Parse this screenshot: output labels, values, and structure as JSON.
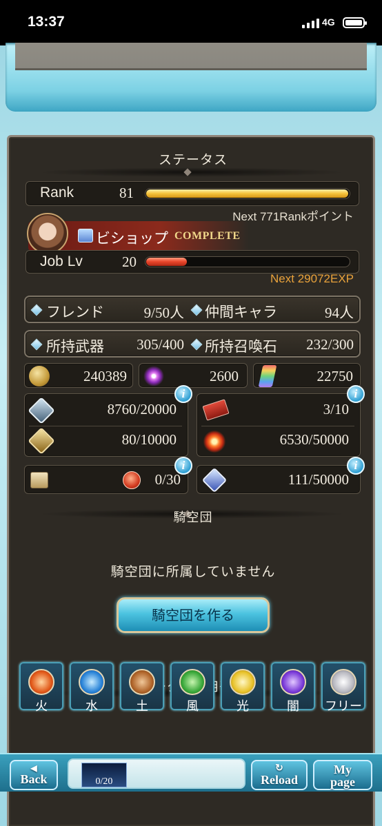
{
  "status_bar": {
    "time": "13:37",
    "network": "4G"
  },
  "status_panel": {
    "title": "ステータス",
    "rank": {
      "label": "Rank",
      "value": "81",
      "progress": 0.99,
      "next_text": "Next 771Rankポイント"
    },
    "job": {
      "class_name": "ビショップ",
      "complete_label": "COMPLETE",
      "label": "Job Lv",
      "value": "20",
      "progress": 0.2,
      "next_text": "Next 29072EXP"
    },
    "friends": {
      "label": "フレンド",
      "value": "9/50人"
    },
    "allies": {
      "label": "仲間キャラ",
      "value": "94人"
    },
    "weapons": {
      "label": "所持武器",
      "value": "305/400"
    },
    "summons": {
      "label": "所持召喚石",
      "value": "232/300"
    },
    "currencies": [
      {
        "icon": "rupie-coin-icon",
        "value": "240389"
      },
      {
        "icon": "crystal-star-icon",
        "value": "2600"
      },
      {
        "icon": "rainbow-crystal-icon",
        "value": "22750"
      }
    ],
    "items": [
      {
        "icon": "ap-potion-icon",
        "value": "8760/20000"
      },
      {
        "icon": "draw-ticket-icon",
        "value": "3/10"
      },
      {
        "icon": "bp-potion-icon",
        "value": "80/10000"
      },
      {
        "icon": "burst-star-icon",
        "value": "6530/50000"
      }
    ],
    "extra": [
      {
        "icon": "treasure-chest-icon",
        "badge_icon": "rank-up-icon",
        "value": "0/30"
      },
      {
        "icon": "heart-gem-icon",
        "value": "111/50000"
      }
    ],
    "info_label": "i"
  },
  "crew": {
    "title": "騎空団",
    "message": "騎空団に所属していません",
    "create_button": "騎空団を作る"
  },
  "support": {
    "title": "サポーター専用召喚石",
    "elements": [
      "火",
      "水",
      "土",
      "風",
      "光",
      "闇",
      "フリー"
    ]
  },
  "bottom_nav": {
    "back": "Back",
    "progress": "0/20",
    "reload": "Reload",
    "mypage_1": "My",
    "mypage_2": "page"
  },
  "colors": {
    "rank_bar": "#f5c23a",
    "job_bar": "#e8452a",
    "next_exp": "#e9a23b"
  }
}
